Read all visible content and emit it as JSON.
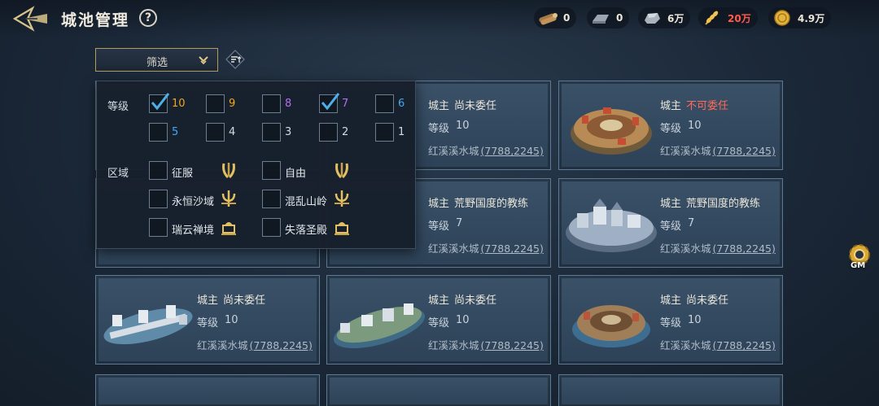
{
  "header": {
    "title": "城池管理",
    "help_label": "?",
    "resources": [
      {
        "icon": "wood-icon",
        "value": "0",
        "color": "#ece7da"
      },
      {
        "icon": "iron-ingot-icon",
        "value": "0",
        "color": "#ece7da"
      },
      {
        "icon": "stone-icon",
        "value": "6万",
        "color": "#ece7da"
      },
      {
        "icon": "grain-icon",
        "value": "20万",
        "color": "#ff5a4a"
      },
      {
        "icon": "gold-coin-icon",
        "value": "4.9万",
        "color": "#ece7da"
      }
    ]
  },
  "filter": {
    "dropdown_label": "筛选",
    "level_label": "等级",
    "levels": [
      {
        "value": "10",
        "checked": true,
        "color": "#f0a623"
      },
      {
        "value": "9",
        "checked": false,
        "color": "#f0a623"
      },
      {
        "value": "8",
        "checked": false,
        "color": "#b46cf2"
      },
      {
        "value": "7",
        "checked": true,
        "color": "#b46cf2"
      },
      {
        "value": "6",
        "checked": false,
        "color": "#4aa6f0"
      },
      {
        "value": "5",
        "checked": false,
        "color": "#4aa6f0"
      },
      {
        "value": "4",
        "checked": false,
        "color": "#d4dbe2"
      },
      {
        "value": "3",
        "checked": false,
        "color": "#d4dbe2"
      },
      {
        "value": "2",
        "checked": false,
        "color": "#d4dbe2"
      },
      {
        "value": "1",
        "checked": false,
        "color": "#d4dbe2"
      }
    ],
    "region_label": "区域",
    "regions": [
      {
        "name": "征服",
        "checked": false,
        "icon": "wheat-emblem-icon"
      },
      {
        "name": "自由",
        "checked": false,
        "icon": "wheat-emblem-icon"
      },
      {
        "name": "永恒沙域",
        "checked": false,
        "icon": "trident-emblem-icon"
      },
      {
        "name": "混乱山岭",
        "checked": false,
        "icon": "trident-emblem-icon"
      },
      {
        "name": "瑞云禅境",
        "checked": false,
        "icon": "temple-emblem-icon"
      },
      {
        "name": "失落圣殿",
        "checked": false,
        "icon": "temple-emblem-icon"
      }
    ]
  },
  "cards": [
    {
      "lord_label": "城主",
      "status": "尚未委任",
      "status_bad": false,
      "level_label": "等级",
      "level": "10",
      "city": "红溪溪水城",
      "coord": "(7788,2245)",
      "thumb": "walled-city-thumbnail"
    },
    {
      "lord_label": "城主",
      "status": "不可委任",
      "status_bad": true,
      "level_label": "等级",
      "level": "10",
      "city": "红溪溪水城",
      "coord": "(7788,2245)",
      "thumb": "round-city-thumbnail"
    },
    {
      "lord_label": "城主",
      "status": "荒野国度的教练",
      "status_bad": false,
      "level_label": "等级",
      "level": "7",
      "city": "红溪溪水城",
      "coord": "(7788,2245)",
      "thumb": "walled-city-thumbnail"
    },
    {
      "lord_label": "城主",
      "status": "荒野国度的教练",
      "status_bad": false,
      "level_label": "等级",
      "level": "7",
      "city": "红溪溪水城",
      "coord": "(7788,2245)",
      "thumb": "fortress-city-thumbnail"
    },
    {
      "lord_label": "城主",
      "status": "尚未委任",
      "status_bad": false,
      "level_label": "等级",
      "level": "10",
      "city": "红溪溪水城",
      "coord": "(7788,2245)",
      "thumb": "bridge-city-thumbnail"
    },
    {
      "lord_label": "城主",
      "status": "尚未委任",
      "status_bad": false,
      "level_label": "等级",
      "level": "10",
      "city": "红溪溪水城",
      "coord": "(7788,2245)",
      "thumb": "island-city-thumbnail"
    },
    {
      "lord_label": "城主",
      "status": "尚未委任",
      "status_bad": false,
      "level_label": "等级",
      "level": "10",
      "city": "红溪溪水城",
      "coord": "(7788,2245)",
      "thumb": "round-city-thumbnail"
    }
  ],
  "gm": {
    "label": "GM"
  }
}
